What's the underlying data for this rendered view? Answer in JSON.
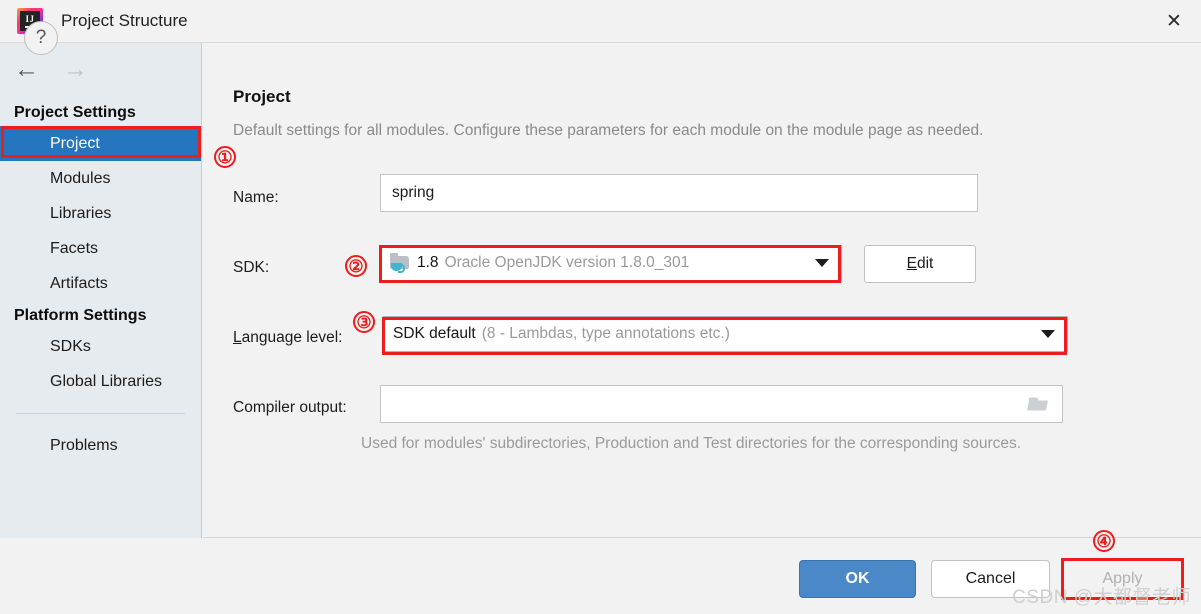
{
  "window": {
    "title": "Project Structure",
    "app_icon": "intellij-idea-logo",
    "close_label": "✕"
  },
  "sidebar": {
    "nav": {
      "back": "←",
      "forward": "→"
    },
    "groups": [
      {
        "heading": "Project Settings",
        "items": [
          {
            "label": "Project",
            "selected": true
          },
          {
            "label": "Modules",
            "selected": false
          },
          {
            "label": "Libraries",
            "selected": false
          },
          {
            "label": "Facets",
            "selected": false
          },
          {
            "label": "Artifacts",
            "selected": false
          }
        ]
      },
      {
        "heading": "Platform Settings",
        "items": [
          {
            "label": "SDKs",
            "selected": false
          },
          {
            "label": "Global Libraries",
            "selected": false
          }
        ]
      }
    ],
    "problems_label": "Problems"
  },
  "main": {
    "title": "Project",
    "description": "Default settings for all modules. Configure these parameters for each module on the module page as needed.",
    "name_row": {
      "label": "Name:",
      "value": "spring"
    },
    "sdk_row": {
      "label": "SDK:",
      "icon": "jdk-folder-cup-icon",
      "value_strong": "1.8",
      "value_gray": "Oracle OpenJDK version 1.8.0_301",
      "edit_button": {
        "mnemonic": "E",
        "rest": "dit"
      }
    },
    "language_row": {
      "label_mnemonic": "L",
      "label_rest": "anguage level:",
      "value_strong": "SDK default",
      "value_gray": "(8 - Lambdas, type annotations etc.)"
    },
    "compiler_row": {
      "label": "Compiler output:",
      "value": "",
      "browse_icon": "folder-browse-icon",
      "hint": "Used for modules' subdirectories, Production and Test directories for the corresponding sources."
    }
  },
  "footer": {
    "help_label": "?",
    "ok_label": "OK",
    "cancel_label": "Cancel",
    "apply_label": "Apply"
  },
  "annotations": {
    "markers": [
      "①",
      "②",
      "③",
      "④"
    ],
    "highlight_color": "#ee1c1c"
  },
  "watermark": "CSDN @大都督老师",
  "colors": {
    "selection_blue": "#2675bf",
    "ok_button_blue": "#4a88c7",
    "sidebar_bg": "#e6ebef",
    "content_bg": "#f2f2f2",
    "annotation_red": "#ee1c1c"
  }
}
